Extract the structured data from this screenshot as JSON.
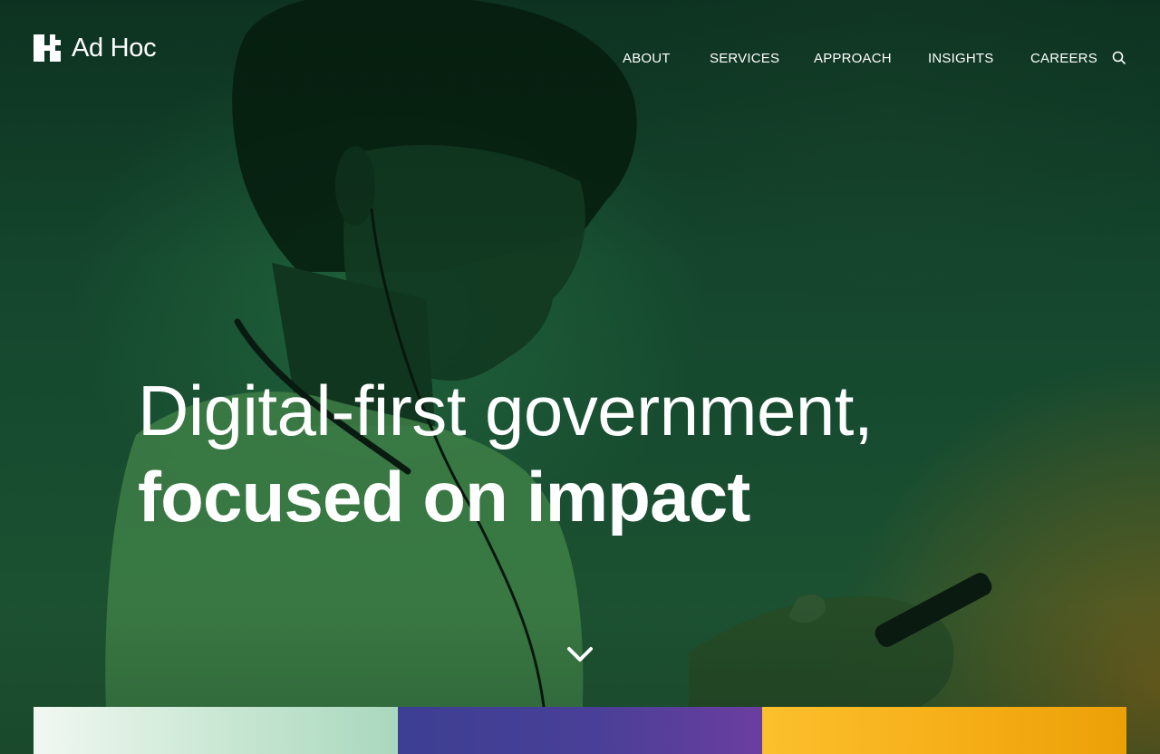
{
  "brand": {
    "name": "Ad Hoc",
    "accent": "#ffffff"
  },
  "nav": {
    "items": [
      {
        "label": "ABOUT"
      },
      {
        "label": "SERVICES"
      },
      {
        "label": "APPROACH"
      },
      {
        "label": "INSIGHTS"
      },
      {
        "label": "CAREERS"
      }
    ],
    "search_icon": "search-icon"
  },
  "hero": {
    "headline_light": "Digital-first government,",
    "headline_bold": "focused on impact",
    "scroll_icon": "chevron-down-icon",
    "background_tint": "#164a2f"
  },
  "tiles": [
    {
      "color_from": "#f1f8f2",
      "color_to": "#a9d8bd"
    },
    {
      "color_from": "#3c3f93",
      "color_to": "#6b3ea0"
    },
    {
      "color_from": "#fbc02d",
      "color_to": "#eba006"
    }
  ]
}
